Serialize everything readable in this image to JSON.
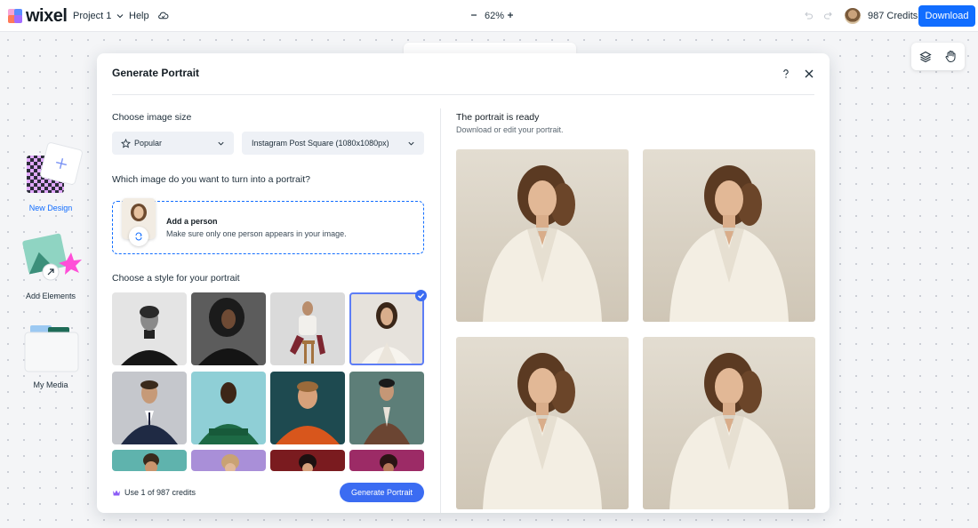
{
  "app": {
    "logo_text": "wixel",
    "project_name": "Project 1",
    "help_label": "Help",
    "zoom_level": "62%",
    "credits_label": "987 Credits",
    "download_label": "Download"
  },
  "sidebar": {
    "items": [
      {
        "label": "New Design",
        "icon": "new-design-icon"
      },
      {
        "label": "Add Elements",
        "icon": "add-elements-icon"
      },
      {
        "label": "My Media",
        "icon": "my-media-icon"
      }
    ]
  },
  "modal": {
    "title": "Generate Portrait",
    "size_section_label": "Choose image size",
    "size_category": "Popular",
    "size_option": "Instagram Post Square (1080x1080px)",
    "image_question": "Which image do you want to turn into a portrait?",
    "add_person_title": "Add a person",
    "add_person_hint": "Make sure only one person appears in your image.",
    "style_section_label": "Choose a style for your portrait",
    "styles": [
      {
        "id": "mono-turtleneck",
        "selected": false
      },
      {
        "id": "black-blazer",
        "selected": false
      },
      {
        "id": "studio-stool",
        "selected": false
      },
      {
        "id": "white-suit",
        "selected": true
      },
      {
        "id": "navy-suit",
        "selected": false
      },
      {
        "id": "green-sweater",
        "selected": false
      },
      {
        "id": "orange-sweater",
        "selected": false
      },
      {
        "id": "brown-jacket",
        "selected": false
      },
      {
        "id": "teal-bg",
        "selected": false
      },
      {
        "id": "purple-bg",
        "selected": false
      },
      {
        "id": "red-bg",
        "selected": false
      },
      {
        "id": "magenta-bg",
        "selected": false
      }
    ],
    "credits_usage": "Use 1 of 987 credits",
    "generate_label": "Generate Portrait",
    "result_title": "The portrait is ready",
    "result_subtitle": "Download or edit your portrait.",
    "results_count": 4
  },
  "colors": {
    "accent": "#116dff",
    "generate_button": "#3b6cf2",
    "selection_outline": "#5d7df6",
    "sidebar_label_active": "#116dff"
  }
}
